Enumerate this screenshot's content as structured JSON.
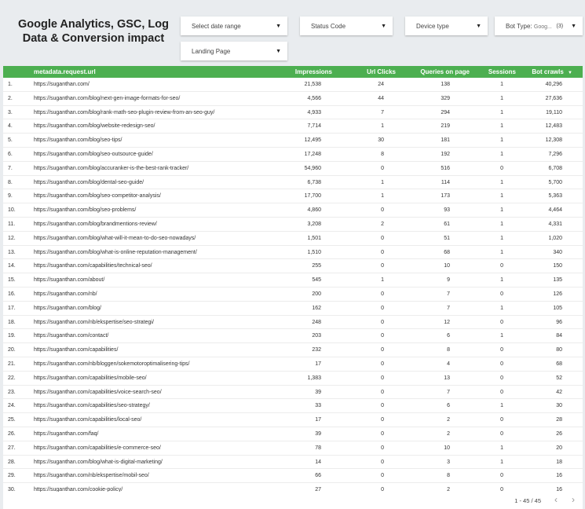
{
  "title": "Google Analytics, GSC, Log Data & Conversion impact",
  "filters": {
    "date_range": "Select date range",
    "status_code": "Status Code",
    "device_type": "Device type",
    "bot_type_label": "Bot Type:",
    "bot_type_value": "Goog...",
    "bot_type_count": "(3)",
    "landing_page": "Landing Page"
  },
  "table": {
    "columns": {
      "url": "metadata.request.url",
      "impressions": "Impressions",
      "clicks": "Url Clicks",
      "queries": "Queries on page",
      "sessions": "Sessions",
      "bot_crawls": "Bot crawls",
      "sort_icon": "caret-down-icon"
    },
    "rows": [
      {
        "idx": "1.",
        "url": "https://suganthan.com/",
        "imp": "21,538",
        "clk": "24",
        "qop": "138",
        "ses": "1",
        "bot": "40,296"
      },
      {
        "idx": "2.",
        "url": "https://suganthan.com/blog/next-gen-image-formats-for-seo/",
        "imp": "4,566",
        "clk": "44",
        "qop": "329",
        "ses": "1",
        "bot": "27,636"
      },
      {
        "idx": "3.",
        "url": "https://suganthan.com/blog/rank-math-seo-plugin-review-from-an-seo-guy/",
        "imp": "4,933",
        "clk": "7",
        "qop": "294",
        "ses": "1",
        "bot": "19,110"
      },
      {
        "idx": "4.",
        "url": "https://suganthan.com/blog/website-redesign-seo/",
        "imp": "7,714",
        "clk": "1",
        "qop": "219",
        "ses": "1",
        "bot": "12,483"
      },
      {
        "idx": "5.",
        "url": "https://suganthan.com/blog/seo-tips/",
        "imp": "12,495",
        "clk": "30",
        "qop": "181",
        "ses": "1",
        "bot": "12,308"
      },
      {
        "idx": "6.",
        "url": "https://suganthan.com/blog/seo-outsource-guide/",
        "imp": "17,248",
        "clk": "8",
        "qop": "192",
        "ses": "1",
        "bot": "7,296"
      },
      {
        "idx": "7.",
        "url": "https://suganthan.com/blog/accuranker-is-the-best-rank-tracker/",
        "imp": "54,960",
        "clk": "0",
        "qop": "516",
        "ses": "0",
        "bot": "6,708"
      },
      {
        "idx": "8.",
        "url": "https://suganthan.com/blog/dental-seo-guide/",
        "imp": "6,738",
        "clk": "1",
        "qop": "114",
        "ses": "1",
        "bot": "5,700"
      },
      {
        "idx": "9.",
        "url": "https://suganthan.com/blog/seo-competitor-analysis/",
        "imp": "17,700",
        "clk": "1",
        "qop": "173",
        "ses": "1",
        "bot": "5,363"
      },
      {
        "idx": "10.",
        "url": "https://suganthan.com/blog/seo-problems/",
        "imp": "4,860",
        "clk": "0",
        "qop": "93",
        "ses": "1",
        "bot": "4,464"
      },
      {
        "idx": "11.",
        "url": "https://suganthan.com/blog/brandmentions-review/",
        "imp": "3,208",
        "clk": "2",
        "qop": "61",
        "ses": "1",
        "bot": "4,331"
      },
      {
        "idx": "12.",
        "url": "https://suganthan.com/blog/what-will-it-mean-to-do-seo-nowadays/",
        "imp": "1,501",
        "clk": "0",
        "qop": "51",
        "ses": "1",
        "bot": "1,020"
      },
      {
        "idx": "13.",
        "url": "https://suganthan.com/blog/what-is-online-reputation-management/",
        "imp": "1,510",
        "clk": "0",
        "qop": "68",
        "ses": "1",
        "bot": "340"
      },
      {
        "idx": "14.",
        "url": "https://suganthan.com/capabilities/technical-seo/",
        "imp": "255",
        "clk": "0",
        "qop": "10",
        "ses": "0",
        "bot": "150"
      },
      {
        "idx": "15.",
        "url": "https://suganthan.com/about/",
        "imp": "545",
        "clk": "1",
        "qop": "9",
        "ses": "1",
        "bot": "135"
      },
      {
        "idx": "16.",
        "url": "https://suganthan.com/nb/",
        "imp": "200",
        "clk": "0",
        "qop": "7",
        "ses": "0",
        "bot": "126"
      },
      {
        "idx": "17.",
        "url": "https://suganthan.com/blog/",
        "imp": "162",
        "clk": "0",
        "qop": "7",
        "ses": "1",
        "bot": "105"
      },
      {
        "idx": "18.",
        "url": "https://suganthan.com/nb/ekspertise/seo-strategi/",
        "imp": "248",
        "clk": "0",
        "qop": "12",
        "ses": "0",
        "bot": "96"
      },
      {
        "idx": "19.",
        "url": "https://suganthan.com/contact/",
        "imp": "203",
        "clk": "0",
        "qop": "6",
        "ses": "1",
        "bot": "84"
      },
      {
        "idx": "20.",
        "url": "https://suganthan.com/capabilities/",
        "imp": "232",
        "clk": "0",
        "qop": "8",
        "ses": "0",
        "bot": "80"
      },
      {
        "idx": "21.",
        "url": "https://suganthan.com/nb/bloggen/sokemotoroptimalisering-tips/",
        "imp": "17",
        "clk": "0",
        "qop": "4",
        "ses": "0",
        "bot": "68"
      },
      {
        "idx": "22.",
        "url": "https://suganthan.com/capabilities/mobile-seo/",
        "imp": "1,383",
        "clk": "0",
        "qop": "13",
        "ses": "0",
        "bot": "52"
      },
      {
        "idx": "23.",
        "url": "https://suganthan.com/capabilities/voice-search-seo/",
        "imp": "39",
        "clk": "0",
        "qop": "7",
        "ses": "0",
        "bot": "42"
      },
      {
        "idx": "24.",
        "url": "https://suganthan.com/capabilities/seo-strategy/",
        "imp": "33",
        "clk": "0",
        "qop": "6",
        "ses": "1",
        "bot": "30"
      },
      {
        "idx": "25.",
        "url": "https://suganthan.com/capabilities/local-seo/",
        "imp": "17",
        "clk": "0",
        "qop": "2",
        "ses": "0",
        "bot": "28"
      },
      {
        "idx": "26.",
        "url": "https://suganthan.com/faq/",
        "imp": "39",
        "clk": "0",
        "qop": "2",
        "ses": "0",
        "bot": "26"
      },
      {
        "idx": "27.",
        "url": "https://suganthan.com/capabilities/e-commerce-seo/",
        "imp": "78",
        "clk": "0",
        "qop": "10",
        "ses": "1",
        "bot": "20"
      },
      {
        "idx": "28.",
        "url": "https://suganthan.com/blog/what-is-digital-marketing/",
        "imp": "14",
        "clk": "0",
        "qop": "3",
        "ses": "1",
        "bot": "18"
      },
      {
        "idx": "29.",
        "url": "https://suganthan.com/nb/ekspertise/mobil-seo/",
        "imp": "66",
        "clk": "0",
        "qop": "8",
        "ses": "0",
        "bot": "16"
      },
      {
        "idx": "30.",
        "url": "https://suganthan.com/cookie-policy/",
        "imp": "27",
        "clk": "0",
        "qop": "2",
        "ses": "0",
        "bot": "16"
      }
    ]
  },
  "pagination": {
    "range": "1 - 45 / 45",
    "prev_icon": "chevron-left-icon",
    "next_icon": "chevron-right-icon",
    "prev_glyph": "‹",
    "next_glyph": "›"
  },
  "colors": {
    "header_bg": "#4caf50",
    "page_bg": "#e9ecef"
  }
}
